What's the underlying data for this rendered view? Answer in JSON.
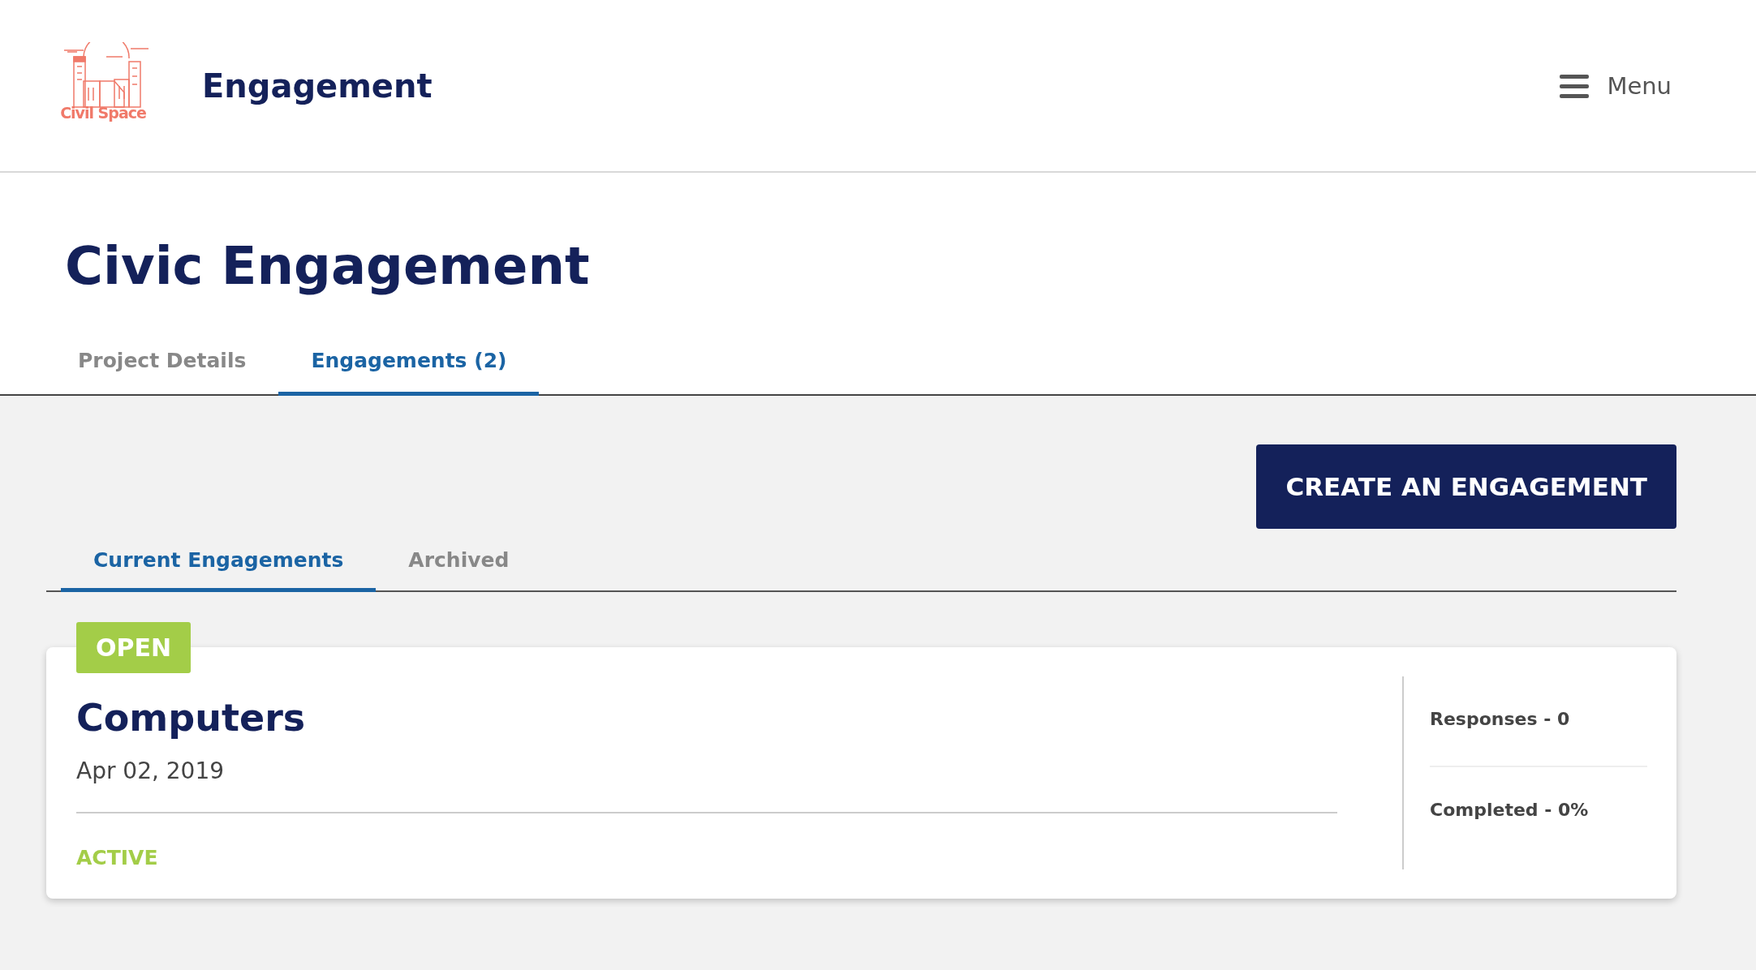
{
  "header": {
    "logo_text": "Civil Space",
    "title": "Engagement",
    "menu_label": "Menu"
  },
  "page_title": "Civic Engagement",
  "tabs": [
    {
      "label": "Project Details",
      "selected": false
    },
    {
      "label": "Engagements (2)",
      "selected": true
    }
  ],
  "create_button": "CREATE AN ENGAGEMENT",
  "sub_tabs": [
    {
      "label": "Current Engagements",
      "selected": true
    },
    {
      "label": "Archived",
      "selected": false
    }
  ],
  "engagements": [
    {
      "badge": "OPEN",
      "title": "Computers",
      "date": "Apr 02, 2019",
      "status": "ACTIVE",
      "stats": [
        "Responses - 0",
        "Completed - 0%"
      ]
    }
  ]
}
